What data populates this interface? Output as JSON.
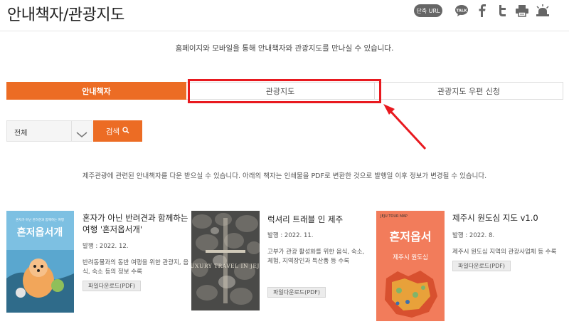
{
  "header": {
    "title": "안내책자/관광지도",
    "url_button": "단축 URL",
    "talk_label": "TALK"
  },
  "intro_text": "홈페이지와 모바일을 통해 안내책자와 관광지도를 만나실 수 있습니다.",
  "tabs": [
    {
      "label": "안내책자",
      "active": true
    },
    {
      "label": "관광지도",
      "active": false
    },
    {
      "label": "관광지도 우편 신청",
      "active": false
    }
  ],
  "filter": {
    "selected": "전체",
    "search_label": "검색"
  },
  "notice_text": "제주관광에 관련된 안내책자를 다운 받으실 수 있습니다. 아래의 책자는 인쇄물을 PDF로 변환한 것으로 발행일 이후 정보가 변경될 수 있습니다.",
  "books": [
    {
      "title": "혼자가 아닌 반려견과 함께하는 여행 '혼저옵서개'",
      "date": "발행 : 2022. 12.",
      "description": "반려동물과의 동반 여행을 위한 관광지, 음식, 숙소 등의 정보 수록",
      "download_label": "파일다운로드(PDF)",
      "cover_text": "혼저옵서개",
      "cover_subtext": "혼자가 아닌 반려견과 함께하는 여행"
    },
    {
      "title": "럭셔리 트래블 인 제주",
      "date": "발행 : 2022. 11.",
      "description": "고부가 관광 활성화를 위한 음식, 숙소, 체험, 지역장인과 특산품 등 수록",
      "download_label": "파일다운로드(PDF)",
      "cover_text": "LUXURY TRAVEL IN JEJU"
    },
    {
      "title": "제주시 원도심 지도 v1.0",
      "date": "발행 : 2022. 8.",
      "description": "제주시 원도심 지역의 관광사업체 등 수록",
      "download_label": "파일다운로드(PDF)",
      "cover_text": "혼저옵서",
      "cover_subtext": "제주시 원도심",
      "cover_label": "JEJU TOUR MAP"
    }
  ],
  "colors": {
    "accent": "#ec6c24",
    "highlight": "#e8191f"
  }
}
